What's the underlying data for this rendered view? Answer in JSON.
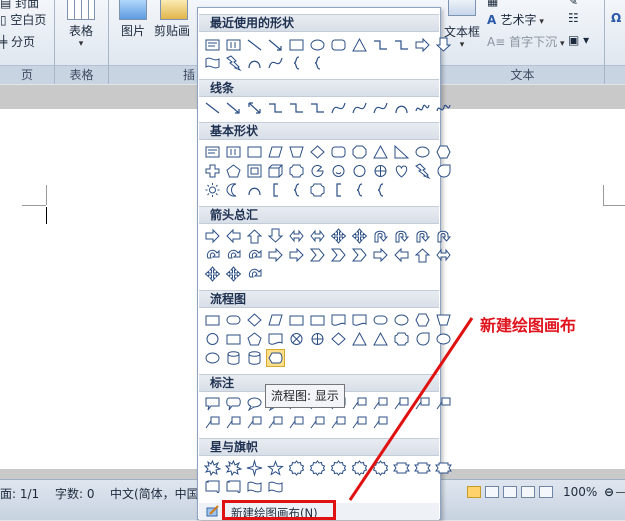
{
  "ribbon": {
    "cover_label": "封面",
    "blank_page_label": "空白页",
    "page_break_label": "分页",
    "pages_group": "页",
    "table_label": "表格",
    "table_group": "表格",
    "picture_label": "图片",
    "clipart_label": "剪贴画",
    "illus_group": "插",
    "textbox_label": "文本框",
    "wordart_label": "艺术字",
    "dropcap_label": "首字下沉",
    "text_group": "文本"
  },
  "panel": {
    "recent_title": "最近使用的形状",
    "lines_title": "线条",
    "basic_title": "基本形状",
    "arrows_title": "箭头总汇",
    "flowchart_title": "流程图",
    "callouts_title": "标注",
    "stars_title": "星与旗帜",
    "new_canvas_label": "新建绘图画布(N)"
  },
  "tooltip": "流程图: 显示",
  "annotation": "新建绘图画布",
  "status": {
    "page": "面: 1/1",
    "words": "字数: 0",
    "language": "中文(简体，中国",
    "zoom": "100%"
  }
}
